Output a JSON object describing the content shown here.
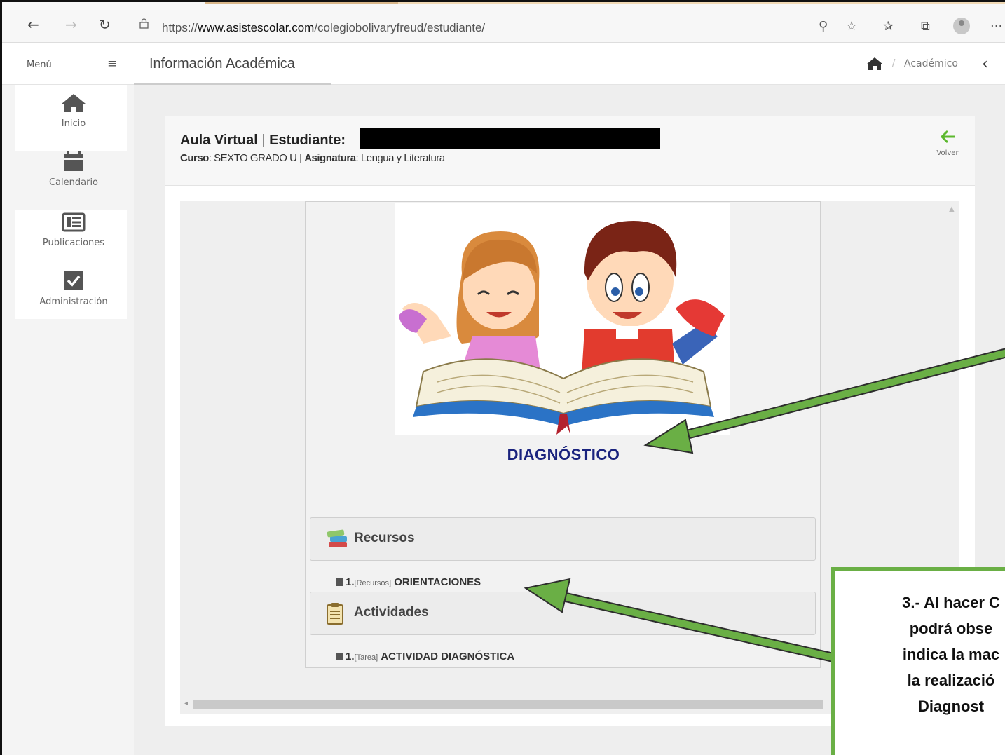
{
  "browser": {
    "url_prefix": "https://",
    "url_domain": "www.asistescolar.com",
    "url_path": "/colegiobolivaryfreud/estudiante/",
    "more": "···"
  },
  "header": {
    "menu_label": "Menú",
    "page_title": "Información Académica",
    "breadcrumb_sep": "/",
    "breadcrumb": "Académico"
  },
  "sidebar": {
    "items": [
      {
        "label": "Inicio",
        "icon": "home-icon"
      },
      {
        "label": "Calendario",
        "icon": "calendar-icon"
      },
      {
        "label": "Publicaciones",
        "icon": "newspaper-icon"
      },
      {
        "label": "Administración",
        "icon": "checkbox-icon"
      }
    ]
  },
  "card": {
    "title_prefix": "Aula Virtual",
    "title_sep": "|",
    "title_label": "Estudiante:",
    "curso_label": "Curso",
    "curso_value": ": SEXTO GRADO U",
    "sep": "|",
    "asignatura_label": "Asignatura",
    "asignatura_value": ": Lengua y Literatura",
    "volver_label": "Volver"
  },
  "content": {
    "illustration_title": "DIAGNÓSTICO",
    "sections": [
      {
        "label": "Recursos",
        "icon": "books-icon",
        "items": [
          {
            "num": "1.",
            "tag": "[Recursos]",
            "name": "ORIENTACIONES"
          }
        ]
      },
      {
        "label": "Actividades",
        "icon": "clipboard-icon",
        "items": [
          {
            "num": "1.",
            "tag": "[Tarea]",
            "name": "ACTIVIDAD DIAGNÓSTICA"
          }
        ]
      }
    ]
  },
  "annotation": {
    "lines": [
      "3.- Al hacer C",
      "podrá obse",
      "indica la mac",
      "la realizació",
      "Diagnost"
    ],
    "color": "#6aaf45"
  }
}
